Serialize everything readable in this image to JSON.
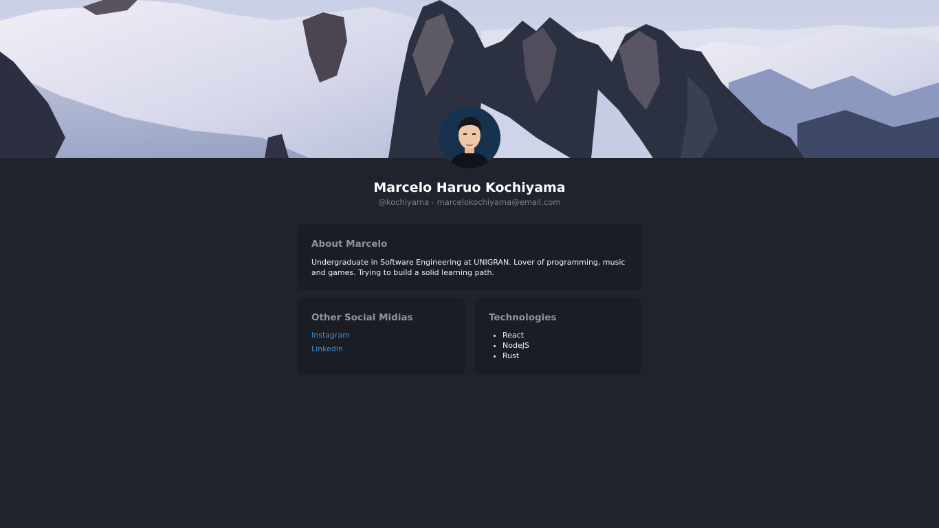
{
  "profile": {
    "name": "Marcelo Haruo Kochiyama",
    "handle_email": "@kochiyama - marcelokochiyama@email.com"
  },
  "about": {
    "title": "About Marcelo",
    "text": "Undergraduate in Software Engineering at UNIGRAN. Lover of programming, music and games. Trying to build a solid learning path."
  },
  "social": {
    "title": "Other Social Midias",
    "links": [
      {
        "label": "Instagram"
      },
      {
        "label": "Linkedin"
      }
    ]
  },
  "technologies": {
    "title": "Technologies",
    "items": [
      "React",
      "NodeJS",
      "Rust"
    ]
  },
  "colors": {
    "background": "#20222c",
    "card": "#1b1d25",
    "link": "#3d8fd6",
    "muted_heading": "#8f929f"
  },
  "icons": {
    "banner": "snowy-mountains-image",
    "avatar": "user-avatar-cartoon"
  }
}
